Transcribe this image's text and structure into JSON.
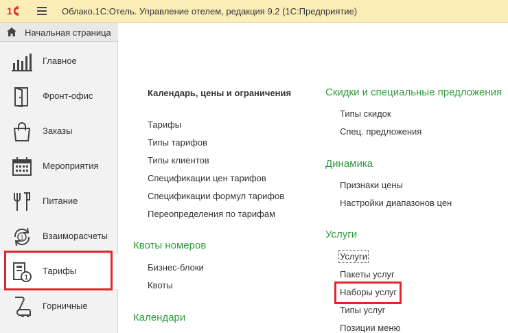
{
  "titlebar": {
    "title": "Облако.1С:Отель. Управление отелем, редакция 9.2  (1С:Предприятие)"
  },
  "sidebar": {
    "home_label": "Начальная страница",
    "items": [
      {
        "label": "Главное",
        "icon": "bar-chart-icon"
      },
      {
        "label": "Фронт-офис",
        "icon": "door-icon"
      },
      {
        "label": "Заказы",
        "icon": "shopping-bag-icon"
      },
      {
        "label": "Мероприятия",
        "icon": "calendar-icon"
      },
      {
        "label": "Питание",
        "icon": "cutlery-icon"
      },
      {
        "label": "Взаиморасчеты",
        "icon": "exchange-icon"
      },
      {
        "label": "Тарифы",
        "icon": "tariff-icon"
      },
      {
        "label": "Горничные",
        "icon": "vacuum-icon"
      }
    ]
  },
  "content": {
    "col1": {
      "calendar_section": {
        "title": "Календарь, цены и ограничения",
        "links": [
          "Тарифы",
          "Типы тарифов",
          "Типы клиентов",
          "Спецификации цен тарифов",
          "Спецификации формул тарифов",
          "Переопределения по тарифам"
        ]
      },
      "quotas_section": {
        "title": "Квоты номеров",
        "links": [
          "Бизнес-блоки",
          "Квоты"
        ]
      },
      "calendars_section": {
        "title": "Календари"
      }
    },
    "col2": {
      "discounts_section": {
        "title": "Скидки и специальные предложения",
        "links": [
          "Типы скидок",
          "Спец. предложения"
        ]
      },
      "dynamics_section": {
        "title": "Динамика",
        "links": [
          "Признаки цены",
          "Настройки диапазонов цен"
        ]
      },
      "services_section": {
        "title": "Услуги",
        "links": [
          "Услуги",
          "Пакеты услуг",
          "Наборы услуг",
          "Типы услуг",
          "Позиции меню"
        ]
      }
    }
  },
  "colors": {
    "titlebar_bg": "#fbedb7",
    "section_green": "#2f9c3f",
    "highlight_red": "#e0262c"
  }
}
